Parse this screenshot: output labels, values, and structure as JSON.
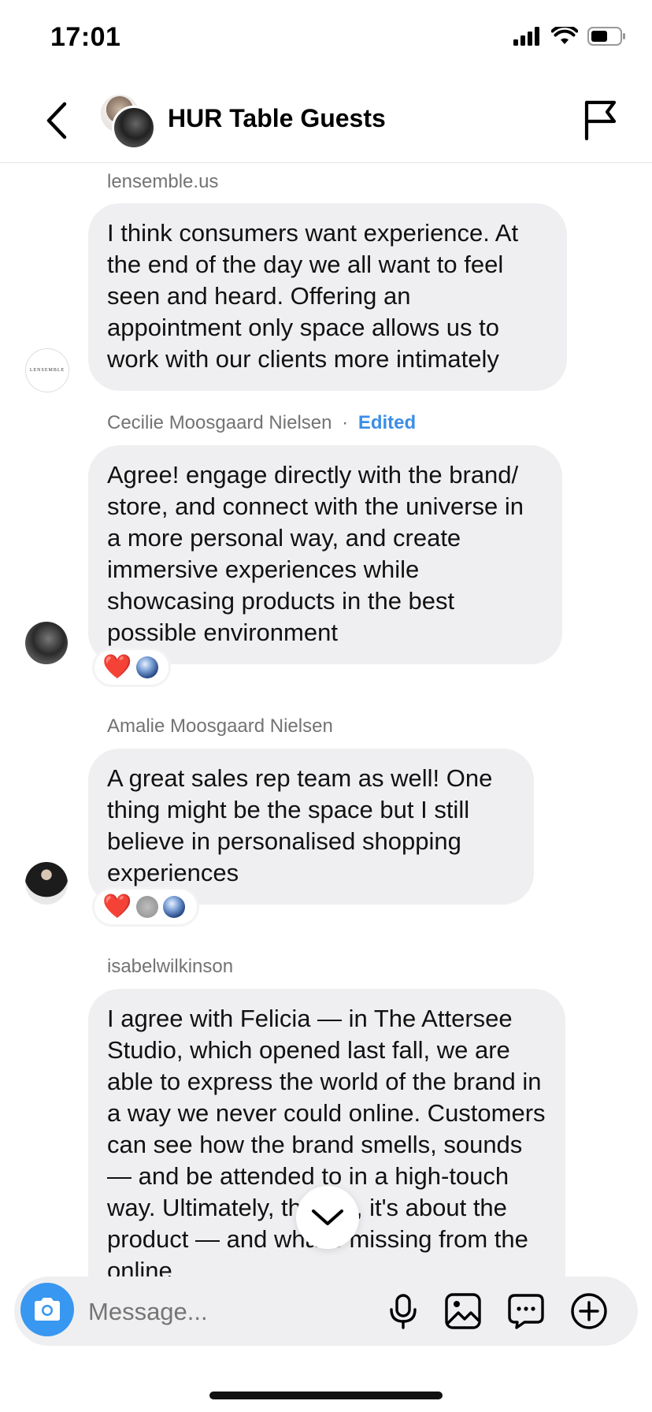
{
  "status_bar": {
    "time": "17:01",
    "icons": [
      "signal-icon",
      "wifi-icon",
      "battery-icon"
    ]
  },
  "header": {
    "title": "HUR Table Guests",
    "back_icon": "chevron-left-icon",
    "flag_icon": "flag-icon"
  },
  "messages": [
    {
      "sender": "lensemble.us",
      "avatar_text": "LENSEMBLE",
      "text": "I think consumers want experience. At the end of the day we all want to feel seen and heard. Offering an appointment only space allows us to work with our clients more intimately"
    },
    {
      "sender": "Cecilie Moosgaard Nielsen",
      "separator": "·",
      "edited_label": "Edited",
      "text": "Agree! engage directly with the brand/ store, and connect with the universe in a more personal way, and create immersive experiences while showcasing products in the best possible environment",
      "reactions": [
        "❤️",
        "earth-avatar"
      ]
    },
    {
      "sender": "Amalie Moosgaard Nielsen",
      "text": "A great sales rep team as well! One thing might be the space but I still believe in personalised shopping experiences",
      "reactions": [
        "❤️",
        "grey-avatar",
        "earth-avatar"
      ]
    },
    {
      "sender": "isabelwilkinson",
      "text": "I agree with Felicia — in The Attersee Studio, which opened last fall, we are able to express the world of the brand in a way we never could online. Customers can see how the brand smells, sounds — and be attended to in a high-touch way. Ultimately, though, it's about the product — and what's missing from the online"
    }
  ],
  "composer": {
    "placeholder": "Message...",
    "icons": [
      "camera-icon",
      "microphone-icon",
      "image-icon",
      "sticker-chat-icon",
      "plus-circle-icon"
    ]
  },
  "colors": {
    "accent": "#3897f0",
    "edited": "#3c8ee6",
    "bubble": "#efeff1",
    "heart": "#e0242e"
  }
}
